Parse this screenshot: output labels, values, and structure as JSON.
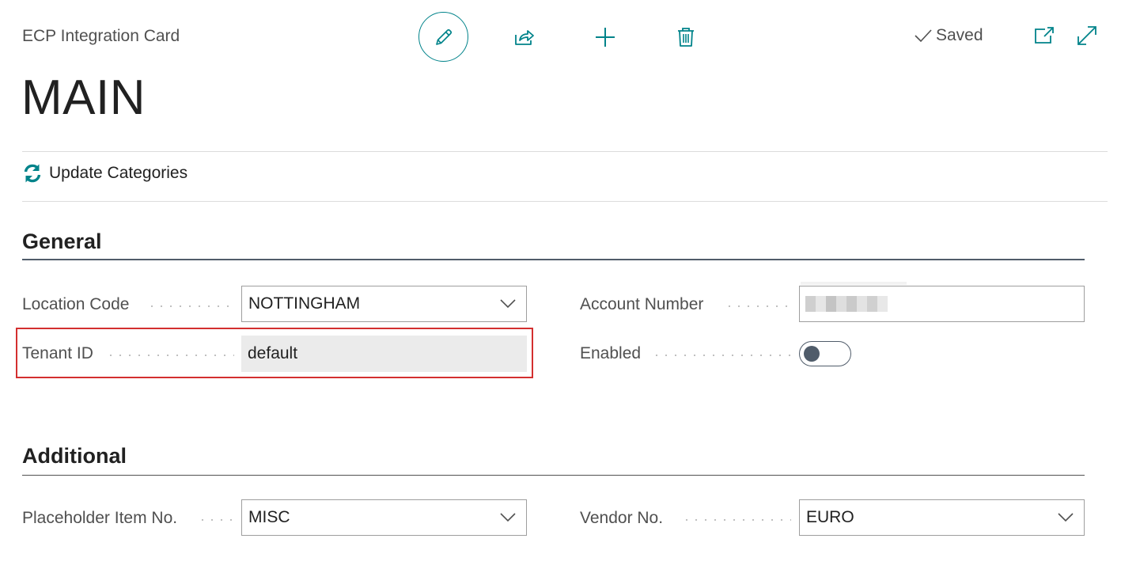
{
  "header": {
    "caption": "ECP Integration Card",
    "record_title": "MAIN",
    "saved_label": "Saved"
  },
  "toolbar": {
    "edit_icon": "pencil-icon",
    "share_icon": "share-icon",
    "new_icon": "plus-icon",
    "delete_icon": "trash-icon",
    "popout_icon": "open-new-window-icon",
    "expand_icon": "expand-icon"
  },
  "actions": {
    "update_categories": "Update Categories"
  },
  "general": {
    "title": "General",
    "location_code": {
      "label": "Location Code",
      "value": "NOTTINGHAM"
    },
    "tenant_id": {
      "label": "Tenant ID",
      "value": "default"
    },
    "account_number": {
      "label": "Account Number"
    },
    "enabled": {
      "label": "Enabled",
      "value": false
    }
  },
  "additional": {
    "title": "Additional",
    "placeholder_item_no": {
      "label": "Placeholder Item No.",
      "value": "MISC"
    },
    "vendor_no": {
      "label": "Vendor No.",
      "value": "EURO"
    }
  },
  "colors": {
    "accent": "#00838a",
    "highlight": "#d32f2f",
    "section_rule": "#505c6a"
  }
}
